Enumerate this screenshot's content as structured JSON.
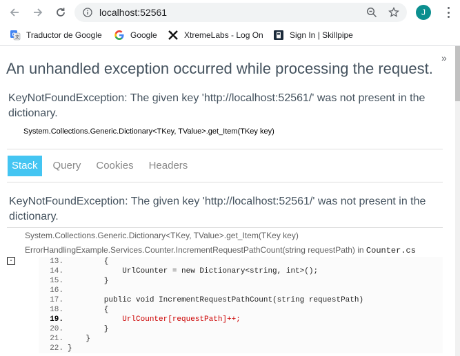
{
  "browser": {
    "url": "localhost:52561",
    "avatar_letter": "J",
    "profile_color": "#0b8f8f"
  },
  "bookmarks": [
    {
      "label": "Traductor de Google",
      "icon": "google-translate-icon"
    },
    {
      "label": "Google",
      "icon": "google-icon"
    },
    {
      "label": "XtremeLabs - Log On",
      "icon": "xtremelabs-icon"
    },
    {
      "label": "Sign In | Skillpipe",
      "icon": "skillpipe-icon"
    }
  ],
  "bookmarks_more": "»",
  "page": {
    "title": "An unhandled exception occurred while processing the request.",
    "exception_summary": "KeyNotFoundException: The given key 'http://localhost:52561/' was not present in the dictionary.",
    "exception_location": "System.Collections.Generic.Dictionary<TKey, TValue>.get_Item(TKey key)",
    "tabs": [
      "Stack",
      "Query",
      "Cookies",
      "Headers"
    ],
    "active_tab": "Stack",
    "accent_color": "#44c5f2",
    "stack": {
      "exception": "KeyNotFoundException: The given key 'http://localhost:52561/' was not present in the dictionary.",
      "frame1": "System.Collections.Generic.Dictionary<TKey, TValue>.get_Item(TKey key)",
      "frame2_method": "ErrorHandlingExample.Services.Counter.IncrementRequestPathCount(string requestPath) in ",
      "frame2_file": "Counter.cs",
      "expander": "-",
      "code": [
        {
          "ln": "13.",
          "src": "        {"
        },
        {
          "ln": "14.",
          "src": "            UrlCounter = new Dictionary<string, int>();"
        },
        {
          "ln": "15.",
          "src": "        }"
        },
        {
          "ln": "16.",
          "src": ""
        },
        {
          "ln": "17.",
          "src": "        public void IncrementRequestPathCount(string requestPath)"
        },
        {
          "ln": "18.",
          "src": "        {"
        },
        {
          "ln": "19.",
          "src": "            UrlCounter[requestPath]++;"
        },
        {
          "ln": "20.",
          "src": "        }"
        },
        {
          "ln": "21.",
          "src": "    }"
        },
        {
          "ln": "22.",
          "src": "}"
        }
      ]
    }
  }
}
